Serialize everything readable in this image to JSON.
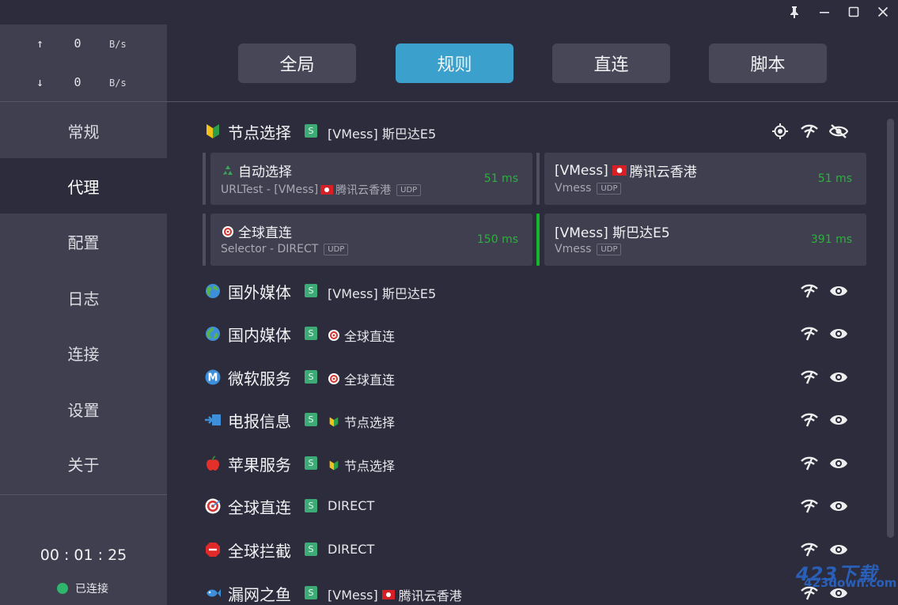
{
  "window": {
    "pin_icon": "pin-icon",
    "minimize_icon": "minimize-icon",
    "maximize_icon": "maximize-icon",
    "close_icon": "close-icon"
  },
  "traffic": {
    "upload": {
      "arrow": "↑",
      "value": "0",
      "unit": "B/s"
    },
    "download": {
      "arrow": "↓",
      "value": "0",
      "unit": "B/s"
    }
  },
  "nav": [
    "常规",
    "代理",
    "配置",
    "日志",
    "连接",
    "设置",
    "关于"
  ],
  "active_nav": "代理",
  "uptime": "00 : 01 : 25",
  "status": "已连接",
  "mode_tabs": [
    "全局",
    "规则",
    "直连",
    "脚本"
  ],
  "active_mode": "规则",
  "badge": "S",
  "groups": [
    {
      "icon": "beginner-badge-icon",
      "name": "节点选择",
      "selected": "[VMess] 斯巴达E5",
      "expanded": true,
      "proxies": [
        {
          "icon": "recycle-icon",
          "name": "自动选择",
          "sub_prefix": "URLTest - [VMess]",
          "sub_flag": "hk-flag-icon",
          "sub_suffix": "腾讯云香港",
          "udp": "UDP",
          "delay": "51 ms"
        },
        {
          "name_prefix": "[VMess]",
          "name_flag": "hk-flag-icon",
          "name": "腾讯云香港",
          "sub": "Vmess",
          "udp": "UDP",
          "delay": "51 ms"
        },
        {
          "icon": "target-icon",
          "name": "全球直连",
          "sub": "Selector - DIRECT",
          "udp": "UDP",
          "delay": "150 ms"
        },
        {
          "name": "[VMess] 斯巴达E5",
          "sub": "Vmess",
          "udp": "UDP",
          "delay": "391 ms",
          "selected": true
        }
      ]
    },
    {
      "icon": "globe-icon",
      "name": "国外媒体",
      "selected": "[VMess] 斯巴达E5"
    },
    {
      "icon": "globe-icon",
      "name": "国内媒体",
      "selected_icon": "target-icon",
      "selected": "全球直连"
    },
    {
      "icon": "metro-m-icon",
      "name": "微软服务",
      "selected_icon": "target-icon",
      "selected": "全球直连"
    },
    {
      "icon": "incoming-envelope-icon",
      "name": "电报信息",
      "selected_icon": "beginner-badge-icon",
      "selected": "节点选择"
    },
    {
      "icon": "apple-icon",
      "name": "苹果服务",
      "selected_icon": "beginner-badge-icon",
      "selected": "节点选择"
    },
    {
      "icon": "target-icon",
      "name": "全球直连",
      "selected": "DIRECT"
    },
    {
      "icon": "stop-sign-icon",
      "name": "全球拦截",
      "selected": "DIRECT"
    },
    {
      "icon": "fish-icon",
      "name": "漏网之鱼",
      "selected_prefix": "[VMess]",
      "selected_icon": "hk-flag-icon",
      "selected": "腾讯云香港"
    }
  ],
  "watermark": {
    "big": "423下载",
    "small": "423down.com"
  },
  "colors": {
    "accent": "#3ba1cc",
    "badge": "#3cab76",
    "delay": "#29b33a",
    "sidebar": "#3f3f4f",
    "background": "#2c2c3c"
  }
}
